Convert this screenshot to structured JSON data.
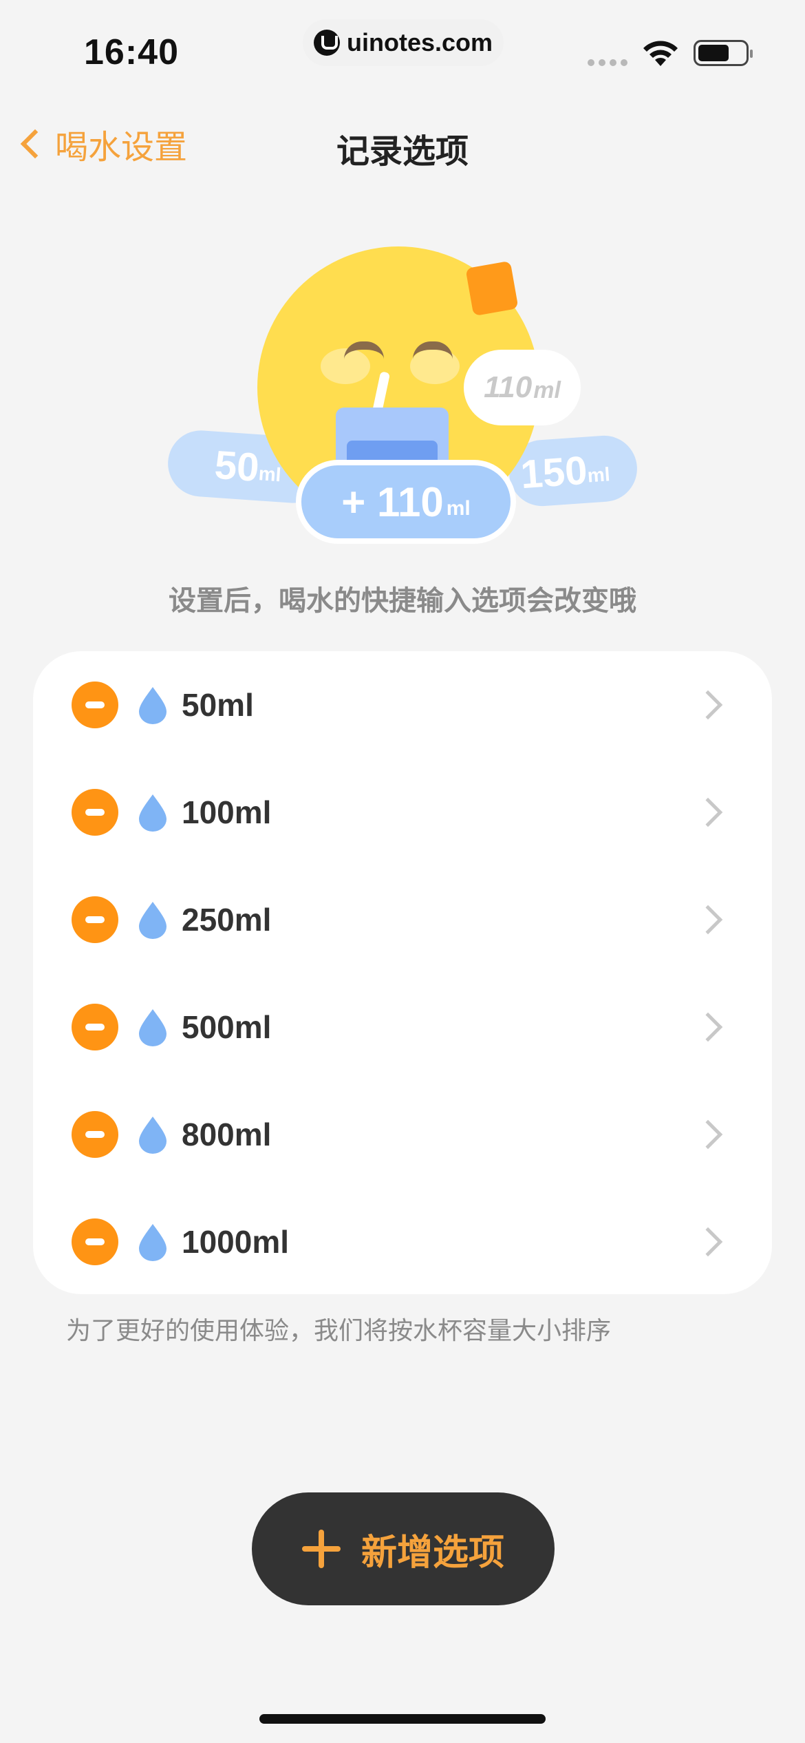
{
  "status_bar": {
    "time": "16:40",
    "site": "uinotes.com",
    "icons": [
      "signal-dots-icon",
      "wifi-icon",
      "battery-icon"
    ]
  },
  "nav": {
    "back_label": "喝水设置",
    "title": "记录选项"
  },
  "hero": {
    "left_value": "50",
    "left_unit": "ml",
    "right_value": "150",
    "right_unit": "ml",
    "center_value": "+ 110",
    "center_unit": "ml",
    "bubble_value": "110",
    "bubble_unit": "ml"
  },
  "hint": "设置后，喝水的快捷输入选项会改变哦",
  "options": [
    {
      "label": "50ml"
    },
    {
      "label": "100ml"
    },
    {
      "label": "250ml"
    },
    {
      "label": "500ml"
    },
    {
      "label": "800ml"
    },
    {
      "label": "1000ml"
    }
  ],
  "note": "为了更好的使用体验，我们将按水杯容量大小排序",
  "add_button": {
    "label": "新增选项"
  },
  "colors": {
    "accent": "#f5a23c",
    "remove": "#ff9414",
    "drop": "#7fb4f5",
    "button_bg": "#333333",
    "background": "#f4f4f4"
  }
}
